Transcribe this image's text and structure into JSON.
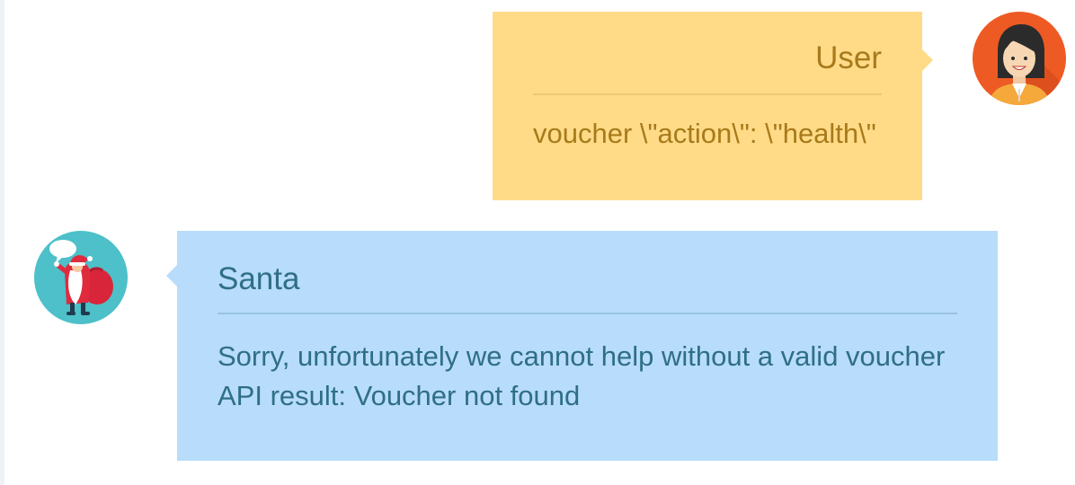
{
  "conversation": {
    "messages": [
      {
        "sender": "User",
        "text": "voucher \\\"action\\\": \\\"health\\\"",
        "avatar_icon": "woman-avatar-icon",
        "bubble_color": "#ffdb88"
      },
      {
        "sender": "Santa",
        "lines": [
          "Sorry, unfortunately we cannot help without a valid voucher",
          "API result: Voucher not found"
        ],
        "avatar_icon": "santa-avatar-icon",
        "bubble_color": "#b8dcfb"
      }
    ]
  }
}
